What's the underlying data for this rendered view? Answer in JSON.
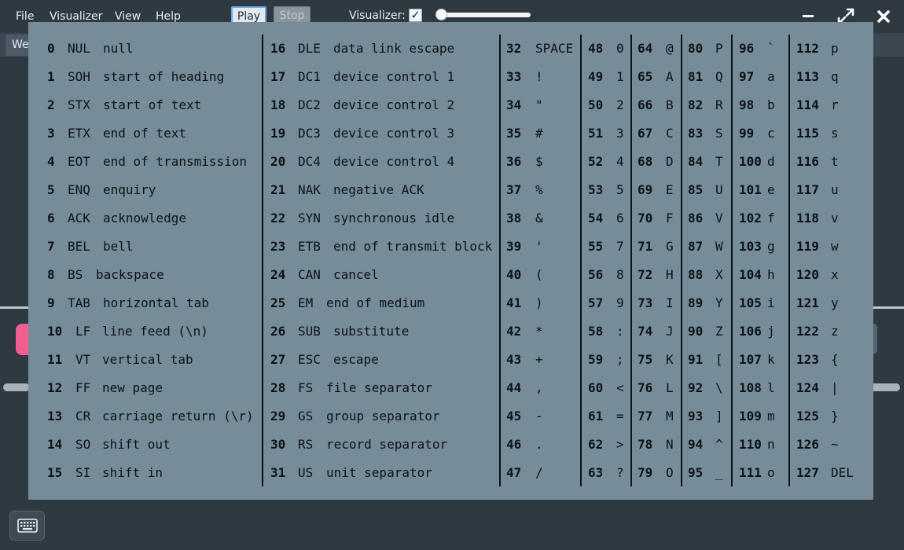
{
  "menu": {
    "items": [
      "File",
      "Visualizer",
      "View",
      "Help"
    ]
  },
  "toolbar": {
    "play_label": "Play",
    "stop_label": "Stop",
    "visualizer_label": "Visualizer:",
    "visualizer_checked": true,
    "visualizer_slider_value": 0
  },
  "window_controls": {
    "minimize_icon": "minimize-icon",
    "maximize_icon": "maximize-icon",
    "close_icon": "close-icon"
  },
  "background": {
    "tab_label": "We"
  },
  "keyboard_button": {
    "icon": "keyboard-icon"
  },
  "colors": {
    "panel_bg": "#768c99",
    "app_bg": "#2f3942",
    "accent_pink": "#f25d8f",
    "play_border": "#69a9e0"
  },
  "ascii_table": {
    "columns": [
      [
        {
          "code": "0",
          "abbr": "NUL",
          "desc": "null"
        },
        {
          "code": "1",
          "abbr": "SOH",
          "desc": "start of heading"
        },
        {
          "code": "2",
          "abbr": "STX",
          "desc": "start of text"
        },
        {
          "code": "3",
          "abbr": "ETX",
          "desc": "end of text"
        },
        {
          "code": "4",
          "abbr": "EOT",
          "desc": "end of transmission"
        },
        {
          "code": "5",
          "abbr": "ENQ",
          "desc": "enquiry"
        },
        {
          "code": "6",
          "abbr": "ACK",
          "desc": "acknowledge"
        },
        {
          "code": "7",
          "abbr": "BEL",
          "desc": "bell"
        },
        {
          "code": "8",
          "abbr": "BS",
          "desc": "backspace"
        },
        {
          "code": "9",
          "abbr": "TAB",
          "desc": "horizontal tab"
        },
        {
          "code": "10",
          "abbr": "LF",
          "desc": "line feed (\\n)"
        },
        {
          "code": "11",
          "abbr": "VT",
          "desc": "vertical tab"
        },
        {
          "code": "12",
          "abbr": "FF",
          "desc": "new page"
        },
        {
          "code": "13",
          "abbr": "CR",
          "desc": "carriage return (\\r)"
        },
        {
          "code": "14",
          "abbr": "SO",
          "desc": "shift out"
        },
        {
          "code": "15",
          "abbr": "SI",
          "desc": "shift in"
        }
      ],
      [
        {
          "code": "16",
          "abbr": "DLE",
          "desc": "data link escape"
        },
        {
          "code": "17",
          "abbr": "DC1",
          "desc": "device control 1"
        },
        {
          "code": "18",
          "abbr": "DC2",
          "desc": "device control 2"
        },
        {
          "code": "19",
          "abbr": "DC3",
          "desc": "device control 3"
        },
        {
          "code": "20",
          "abbr": "DC4",
          "desc": "device control 4"
        },
        {
          "code": "21",
          "abbr": "NAK",
          "desc": "negative ACK"
        },
        {
          "code": "22",
          "abbr": "SYN",
          "desc": "synchronous idle"
        },
        {
          "code": "23",
          "abbr": "ETB",
          "desc": "end of transmit block"
        },
        {
          "code": "24",
          "abbr": "CAN",
          "desc": "cancel"
        },
        {
          "code": "25",
          "abbr": "EM",
          "desc": "end of medium"
        },
        {
          "code": "26",
          "abbr": "SUB",
          "desc": "substitute"
        },
        {
          "code": "27",
          "abbr": "ESC",
          "desc": "escape"
        },
        {
          "code": "28",
          "abbr": "FS",
          "desc": "file separator"
        },
        {
          "code": "29",
          "abbr": "GS",
          "desc": "group separator"
        },
        {
          "code": "30",
          "abbr": "RS",
          "desc": "record separator"
        },
        {
          "code": "31",
          "abbr": "US",
          "desc": "unit separator"
        }
      ],
      [
        {
          "code": "32",
          "char": "SPACE"
        },
        {
          "code": "33",
          "char": "!"
        },
        {
          "code": "34",
          "char": "\""
        },
        {
          "code": "35",
          "char": "#"
        },
        {
          "code": "36",
          "char": "$"
        },
        {
          "code": "37",
          "char": "%"
        },
        {
          "code": "38",
          "char": "&"
        },
        {
          "code": "39",
          "char": "'"
        },
        {
          "code": "40",
          "char": "("
        },
        {
          "code": "41",
          "char": ")"
        },
        {
          "code": "42",
          "char": "*"
        },
        {
          "code": "43",
          "char": "+"
        },
        {
          "code": "44",
          "char": ","
        },
        {
          "code": "45",
          "char": "-"
        },
        {
          "code": "46",
          "char": "."
        },
        {
          "code": "47",
          "char": "/"
        }
      ],
      [
        {
          "code": "48",
          "char": "0"
        },
        {
          "code": "49",
          "char": "1"
        },
        {
          "code": "50",
          "char": "2"
        },
        {
          "code": "51",
          "char": "3"
        },
        {
          "code": "52",
          "char": "4"
        },
        {
          "code": "53",
          "char": "5"
        },
        {
          "code": "54",
          "char": "6"
        },
        {
          "code": "55",
          "char": "7"
        },
        {
          "code": "56",
          "char": "8"
        },
        {
          "code": "57",
          "char": "9"
        },
        {
          "code": "58",
          "char": ":"
        },
        {
          "code": "59",
          "char": ";"
        },
        {
          "code": "60",
          "char": "<"
        },
        {
          "code": "61",
          "char": "="
        },
        {
          "code": "62",
          "char": ">"
        },
        {
          "code": "63",
          "char": "?"
        }
      ],
      [
        {
          "code": "64",
          "char": "@"
        },
        {
          "code": "65",
          "char": "A"
        },
        {
          "code": "66",
          "char": "B"
        },
        {
          "code": "67",
          "char": "C"
        },
        {
          "code": "68",
          "char": "D"
        },
        {
          "code": "69",
          "char": "E"
        },
        {
          "code": "70",
          "char": "F"
        },
        {
          "code": "71",
          "char": "G"
        },
        {
          "code": "72",
          "char": "H"
        },
        {
          "code": "73",
          "char": "I"
        },
        {
          "code": "74",
          "char": "J"
        },
        {
          "code": "75",
          "char": "K"
        },
        {
          "code": "76",
          "char": "L"
        },
        {
          "code": "77",
          "char": "M"
        },
        {
          "code": "78",
          "char": "N"
        },
        {
          "code": "79",
          "char": "O"
        }
      ],
      [
        {
          "code": "80",
          "char": "P"
        },
        {
          "code": "81",
          "char": "Q"
        },
        {
          "code": "82",
          "char": "R"
        },
        {
          "code": "83",
          "char": "S"
        },
        {
          "code": "84",
          "char": "T"
        },
        {
          "code": "85",
          "char": "U"
        },
        {
          "code": "86",
          "char": "V"
        },
        {
          "code": "87",
          "char": "W"
        },
        {
          "code": "88",
          "char": "X"
        },
        {
          "code": "89",
          "char": "Y"
        },
        {
          "code": "90",
          "char": "Z"
        },
        {
          "code": "91",
          "char": "["
        },
        {
          "code": "92",
          "char": "\\"
        },
        {
          "code": "93",
          "char": "]"
        },
        {
          "code": "94",
          "char": "^"
        },
        {
          "code": "95",
          "char": "_"
        }
      ],
      [
        {
          "code": "96",
          "char": "`"
        },
        {
          "code": "97",
          "char": "a"
        },
        {
          "code": "98",
          "char": "b"
        },
        {
          "code": "99",
          "char": "c"
        },
        {
          "code": "100",
          "char": "d"
        },
        {
          "code": "101",
          "char": "e"
        },
        {
          "code": "102",
          "char": "f"
        },
        {
          "code": "103",
          "char": "g"
        },
        {
          "code": "104",
          "char": "h"
        },
        {
          "code": "105",
          "char": "i"
        },
        {
          "code": "106",
          "char": "j"
        },
        {
          "code": "107",
          "char": "k"
        },
        {
          "code": "108",
          "char": "l"
        },
        {
          "code": "109",
          "char": "m"
        },
        {
          "code": "110",
          "char": "n"
        },
        {
          "code": "111",
          "char": "o"
        }
      ],
      [
        {
          "code": "112",
          "char": "p"
        },
        {
          "code": "113",
          "char": "q"
        },
        {
          "code": "114",
          "char": "r"
        },
        {
          "code": "115",
          "char": "s"
        },
        {
          "code": "116",
          "char": "t"
        },
        {
          "code": "117",
          "char": "u"
        },
        {
          "code": "118",
          "char": "v"
        },
        {
          "code": "119",
          "char": "w"
        },
        {
          "code": "120",
          "char": "x"
        },
        {
          "code": "121",
          "char": "y"
        },
        {
          "code": "122",
          "char": "z"
        },
        {
          "code": "123",
          "char": "{"
        },
        {
          "code": "124",
          "char": "|"
        },
        {
          "code": "125",
          "char": "}"
        },
        {
          "code": "126",
          "char": "~"
        },
        {
          "code": "127",
          "char": "DEL"
        }
      ]
    ]
  }
}
